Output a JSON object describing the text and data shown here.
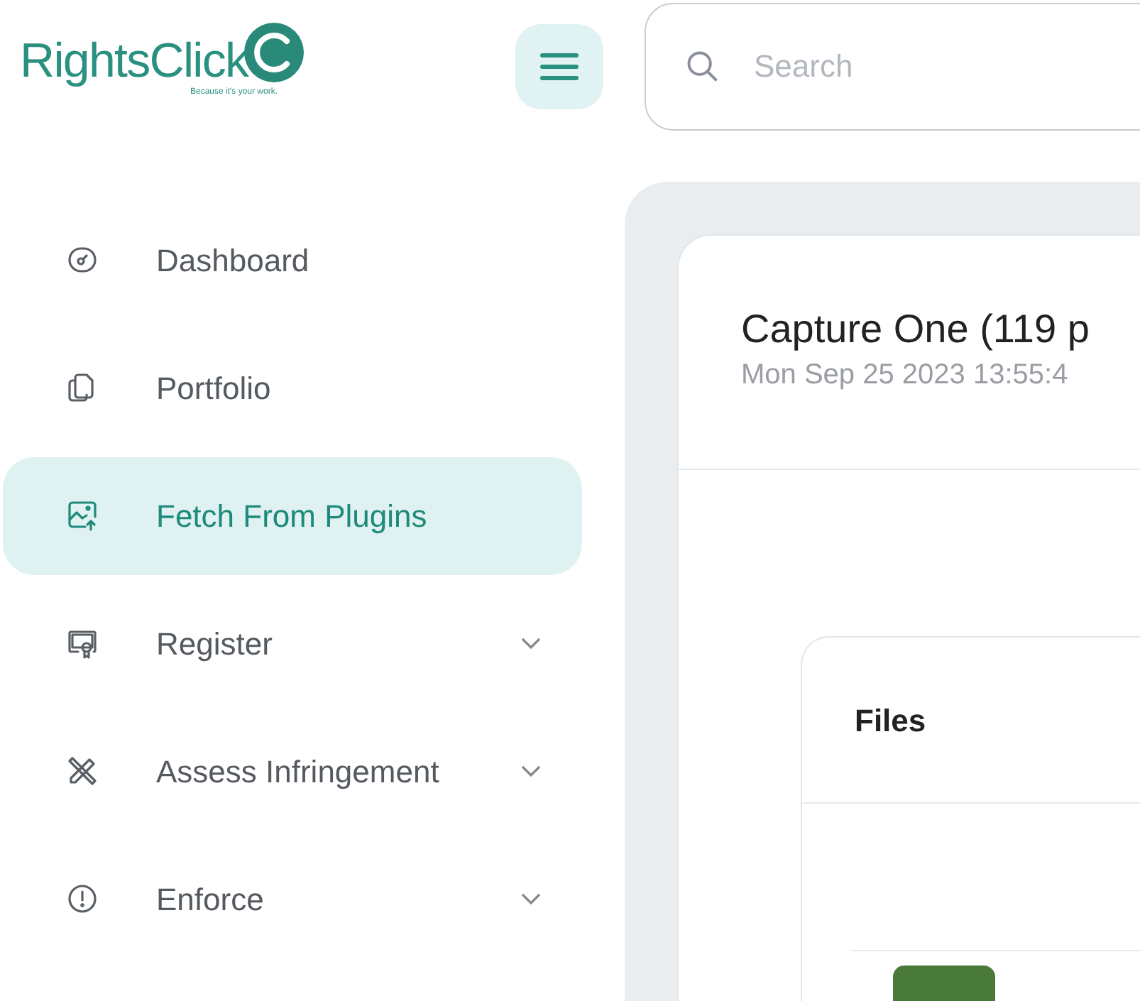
{
  "logo": {
    "name": "RightsClick",
    "tagline": "Because it's your work."
  },
  "search": {
    "placeholder": "Search"
  },
  "sidebar": {
    "items": [
      {
        "kind": "dashboard",
        "label": "Dashboard",
        "selected": false,
        "expandable": false
      },
      {
        "kind": "portfolio",
        "label": "Portfolio",
        "selected": false,
        "expandable": false
      },
      {
        "kind": "fetch",
        "label": "Fetch From Plugins",
        "selected": true,
        "expandable": false
      },
      {
        "kind": "register",
        "label": "Register",
        "selected": false,
        "expandable": true
      },
      {
        "kind": "assess",
        "label": "Assess Infringement",
        "selected": false,
        "expandable": true
      },
      {
        "kind": "enforce",
        "label": "Enforce",
        "selected": false,
        "expandable": true
      }
    ]
  },
  "main": {
    "title": "Capture One (119 p",
    "subtitle": "Mon Sep 25 2023 13:55:4",
    "files_card": {
      "title": "Files"
    }
  }
}
